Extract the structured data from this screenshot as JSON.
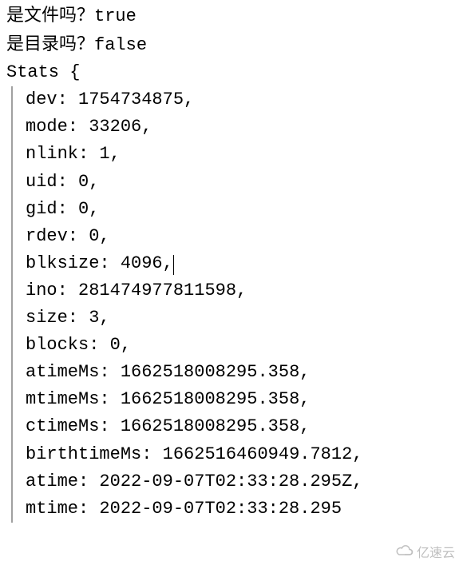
{
  "lines": {
    "q1_label": "是文件吗？",
    "q1_value": "true",
    "q2_label": "是目录吗？",
    "q2_value": "false",
    "stats_header": "Stats {"
  },
  "props": [
    {
      "key": "dev",
      "value": "1754734875",
      "trailing_comma": true,
      "cursor": false
    },
    {
      "key": "mode",
      "value": "33206",
      "trailing_comma": true,
      "cursor": false
    },
    {
      "key": "nlink",
      "value": "1",
      "trailing_comma": true,
      "cursor": false
    },
    {
      "key": "uid",
      "value": "0",
      "trailing_comma": true,
      "cursor": false
    },
    {
      "key": "gid",
      "value": "0",
      "trailing_comma": true,
      "cursor": false
    },
    {
      "key": "rdev",
      "value": "0",
      "trailing_comma": true,
      "cursor": false
    },
    {
      "key": "blksize",
      "value": "4096",
      "trailing_comma": true,
      "cursor": true
    },
    {
      "key": "ino",
      "value": "281474977811598",
      "trailing_comma": true,
      "cursor": false
    },
    {
      "key": "size",
      "value": "3",
      "trailing_comma": true,
      "cursor": false
    },
    {
      "key": "blocks",
      "value": "0",
      "trailing_comma": true,
      "cursor": false
    },
    {
      "key": "atimeMs",
      "value": "1662518008295.358",
      "trailing_comma": true,
      "cursor": false
    },
    {
      "key": "mtimeMs",
      "value": "1662518008295.358",
      "trailing_comma": true,
      "cursor": false
    },
    {
      "key": "ctimeMs",
      "value": "1662518008295.358",
      "trailing_comma": true,
      "cursor": false
    },
    {
      "key": "birthtimeMs",
      "value": "1662516460949.7812",
      "trailing_comma": true,
      "cursor": false
    },
    {
      "key": "atime",
      "value": "2022-09-07T02:33:28.295Z",
      "trailing_comma": true,
      "cursor": false
    },
    {
      "key": "mtime",
      "value": "2022-09-07T02:33:28.295",
      "trailing_comma": false,
      "cursor": false
    }
  ],
  "watermark": {
    "text": "亿速云"
  }
}
